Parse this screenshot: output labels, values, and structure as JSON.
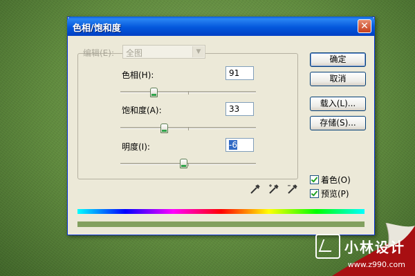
{
  "window": {
    "title": "色相/饱和度",
    "close_glyph": "✕"
  },
  "edit": {
    "label": "编辑(E):",
    "selected": "全图",
    "disabled": true
  },
  "sliders": [
    {
      "label": "色相(H):",
      "value": "91",
      "min": -180,
      "max": 180
    },
    {
      "label": "饱和度(A):",
      "value": "33",
      "min": -100,
      "max": 100
    },
    {
      "label": "明度(I):",
      "value": "-6",
      "min": -100,
      "max": 100
    }
  ],
  "buttons": {
    "ok": "确定",
    "cancel": "取消",
    "load": "载入(L)...",
    "save": "存储(S)..."
  },
  "options": {
    "colorize": {
      "label": "着色(O)",
      "checked": true
    },
    "preview": {
      "label": "预览(P)",
      "checked": true
    }
  },
  "eyedroppers": [
    "eyedropper-icon",
    "eyedropper-plus-icon",
    "eyedropper-minus-icon"
  ],
  "colors": {
    "titlebar": "#0458dc",
    "dialog_bg": "#ece9d8",
    "result_color": "#82a05f",
    "curl_red": "#a80f12"
  },
  "watermark": {
    "name": "小林设计",
    "url": "www.z990.com"
  }
}
